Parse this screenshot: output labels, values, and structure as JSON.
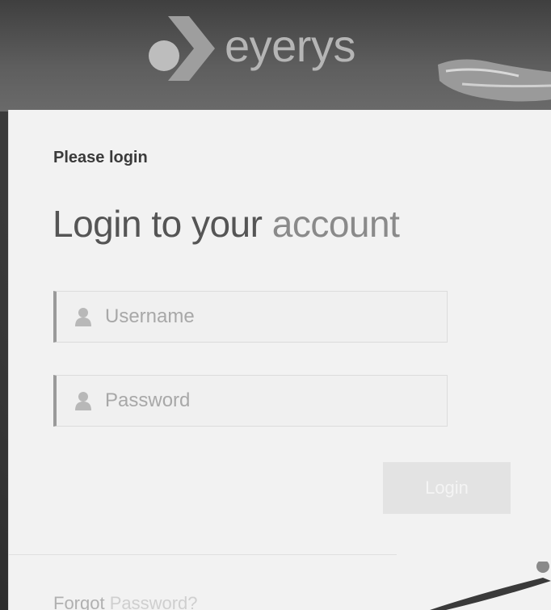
{
  "brand": {
    "logo_text": "eyerys"
  },
  "login": {
    "kicker": "Please login",
    "title_part1": "Login to your ",
    "title_part2": "account",
    "username_placeholder": "Username",
    "password_placeholder": "Password",
    "login_button_label": "Login",
    "forgot_part1": "Forgot ",
    "forgot_part2": "Password?"
  },
  "icons": {
    "username_icon": "user-icon",
    "password_icon": "user-icon"
  },
  "colors": {
    "card_background": "#f2f2f2",
    "page_background": "#4a4a4a",
    "button_background": "#e3e3e3"
  }
}
